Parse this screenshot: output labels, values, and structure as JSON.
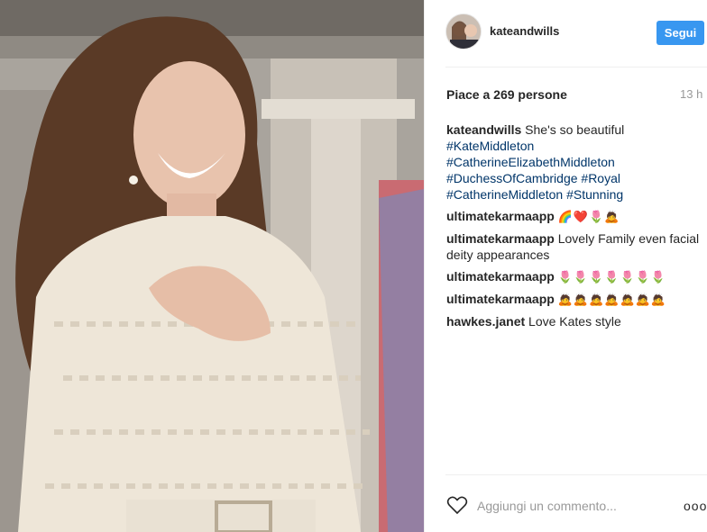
{
  "post": {
    "username": "kateandwills",
    "follow_label": "Segui",
    "likes": "Piace a 269 persone",
    "time": "13 h",
    "caption": {
      "username": "kateandwills",
      "text": "She's so beautiful",
      "tags_line1": "#KateMiddleton",
      "tags_line2": "#CatherineElizabethMiddleton",
      "tags_line3a": "#DuchessOfCambridge",
      "tags_line3b": "#Royal",
      "tags_line4a": "#CatherineMiddleton",
      "tags_line4b": "#Stunning"
    },
    "comments": [
      {
        "username": "ultimatekarmaapp",
        "text": "🌈❤️🌷🙇"
      },
      {
        "username": "ultimatekarmaapp",
        "text": "Lovely Family even facial deity appearances"
      },
      {
        "username": "ultimatekarmaapp",
        "text": "🌷🌷🌷🌷🌷🌷🌷"
      },
      {
        "username": "ultimatekarmaapp",
        "text": "🙇🙇🙇🙇🙇🙇🙇"
      },
      {
        "username": "hawkes.janet",
        "text": "Love Kates style"
      }
    ],
    "comment_placeholder": "Aggiungi un commento...",
    "more_label": "ooo"
  },
  "icons": {
    "like": "heart-outline-icon",
    "more": "more-options-icon"
  },
  "colors": {
    "follow_button": "#3897f0",
    "hashtag": "#003569",
    "muted": "#999999"
  }
}
